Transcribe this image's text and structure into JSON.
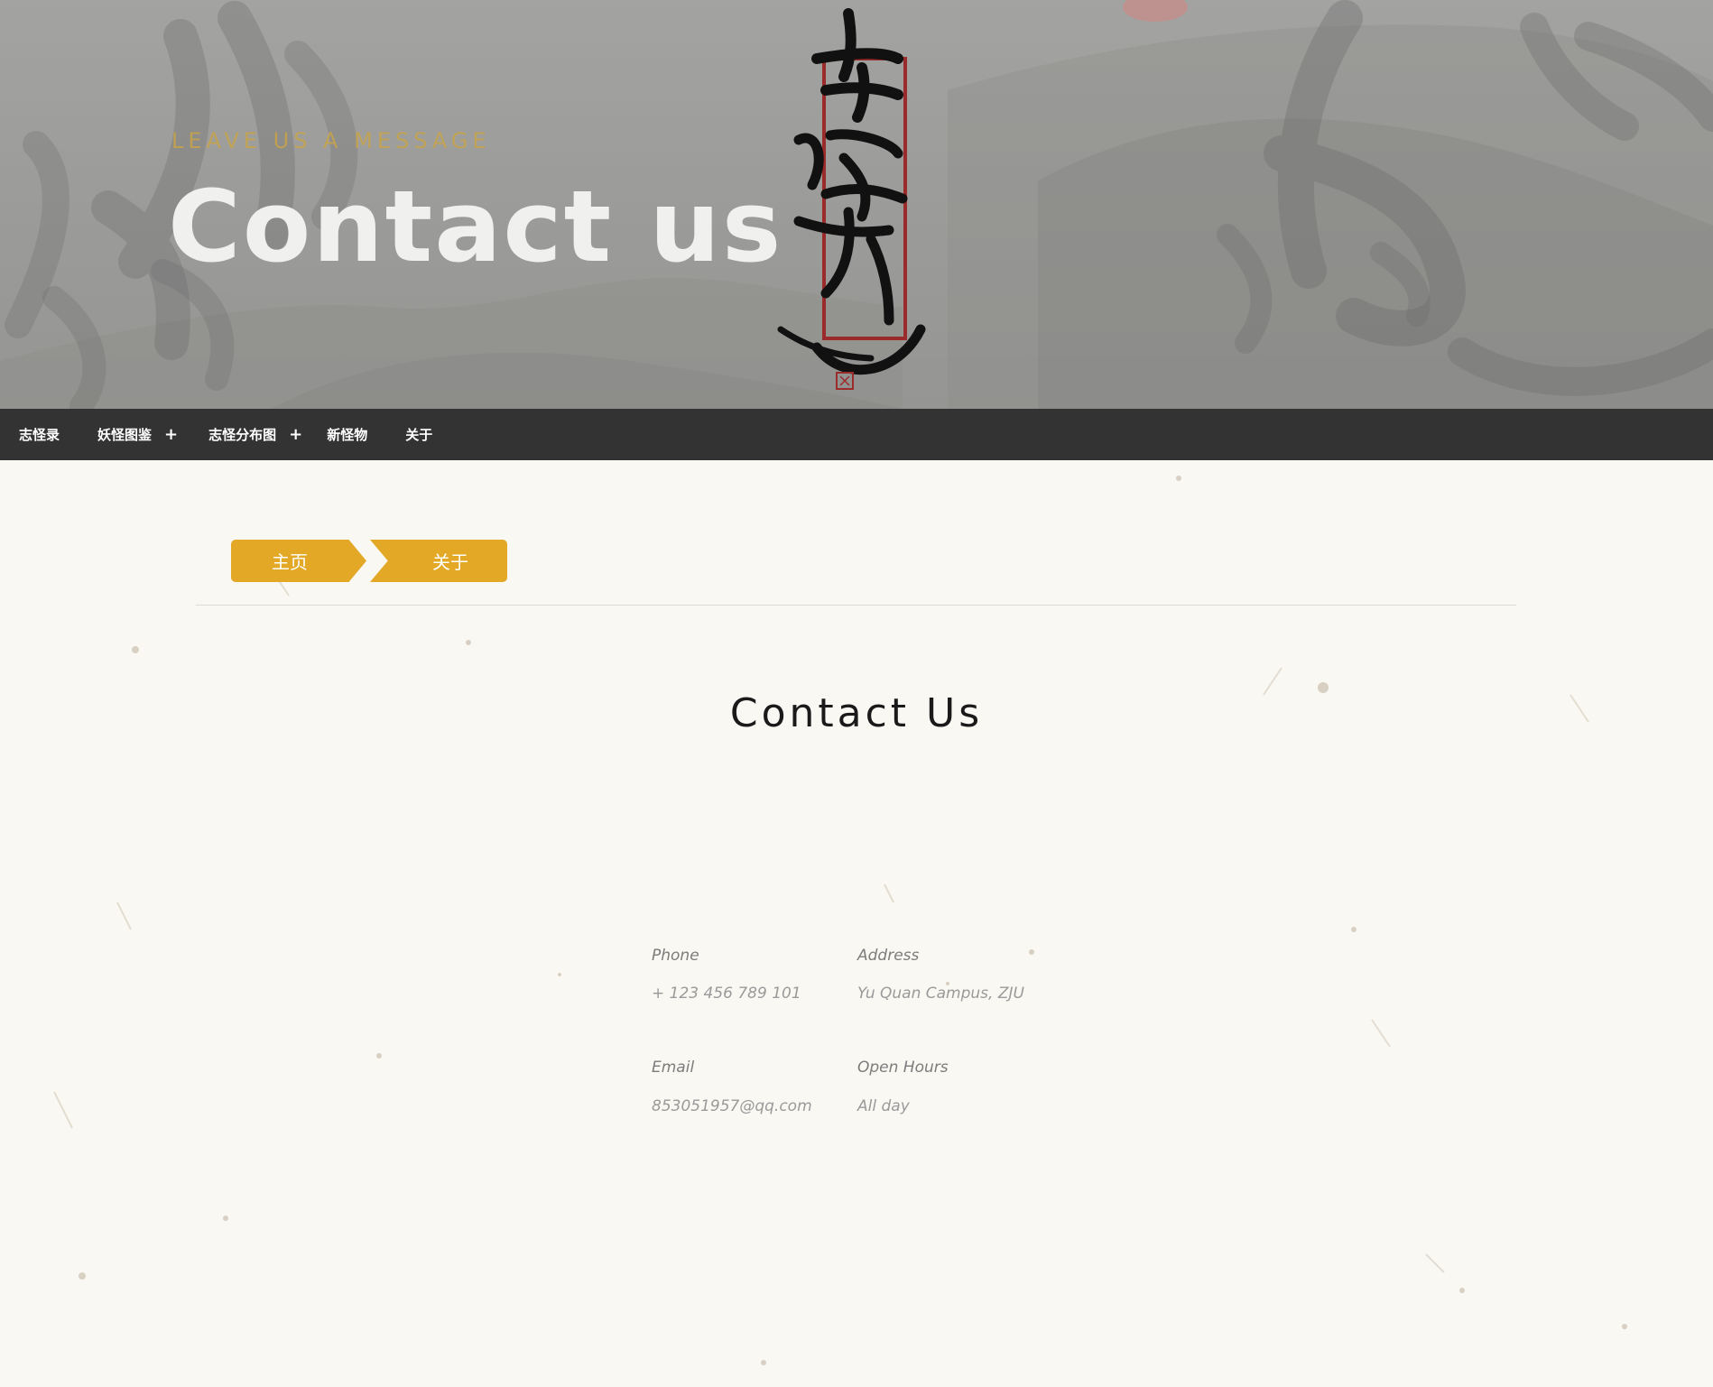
{
  "hero": {
    "eyebrow": "LEAVE US A MESSAGE",
    "title": "Contact us",
    "logo_text": "志怪录"
  },
  "nav": {
    "items": [
      {
        "label": "志怪录",
        "has_submenu": false
      },
      {
        "label": "妖怪图鉴",
        "has_submenu": true
      },
      {
        "label": "志怪分布图",
        "has_submenu": true
      },
      {
        "label": "新怪物",
        "has_submenu": false
      },
      {
        "label": "关于",
        "has_submenu": false
      }
    ],
    "submenu_icon": "+"
  },
  "breadcrumb": {
    "home": "主页",
    "current": "关于"
  },
  "contact": {
    "title": "Contact Us",
    "phone_label": "Phone",
    "phone_value": "+ 123 456 789 101",
    "address_label": "Address",
    "address_value": "Yu Quan Campus, ZJU",
    "email_label": "Email",
    "email_value": "853051957@qq.com",
    "hours_label": "Open Hours",
    "hours_value": "All day"
  },
  "colors": {
    "accent": "#e2a826",
    "nav_bg": "#333333",
    "page_bg": "#faf8f3",
    "seal_red": "#9b2a2a"
  }
}
